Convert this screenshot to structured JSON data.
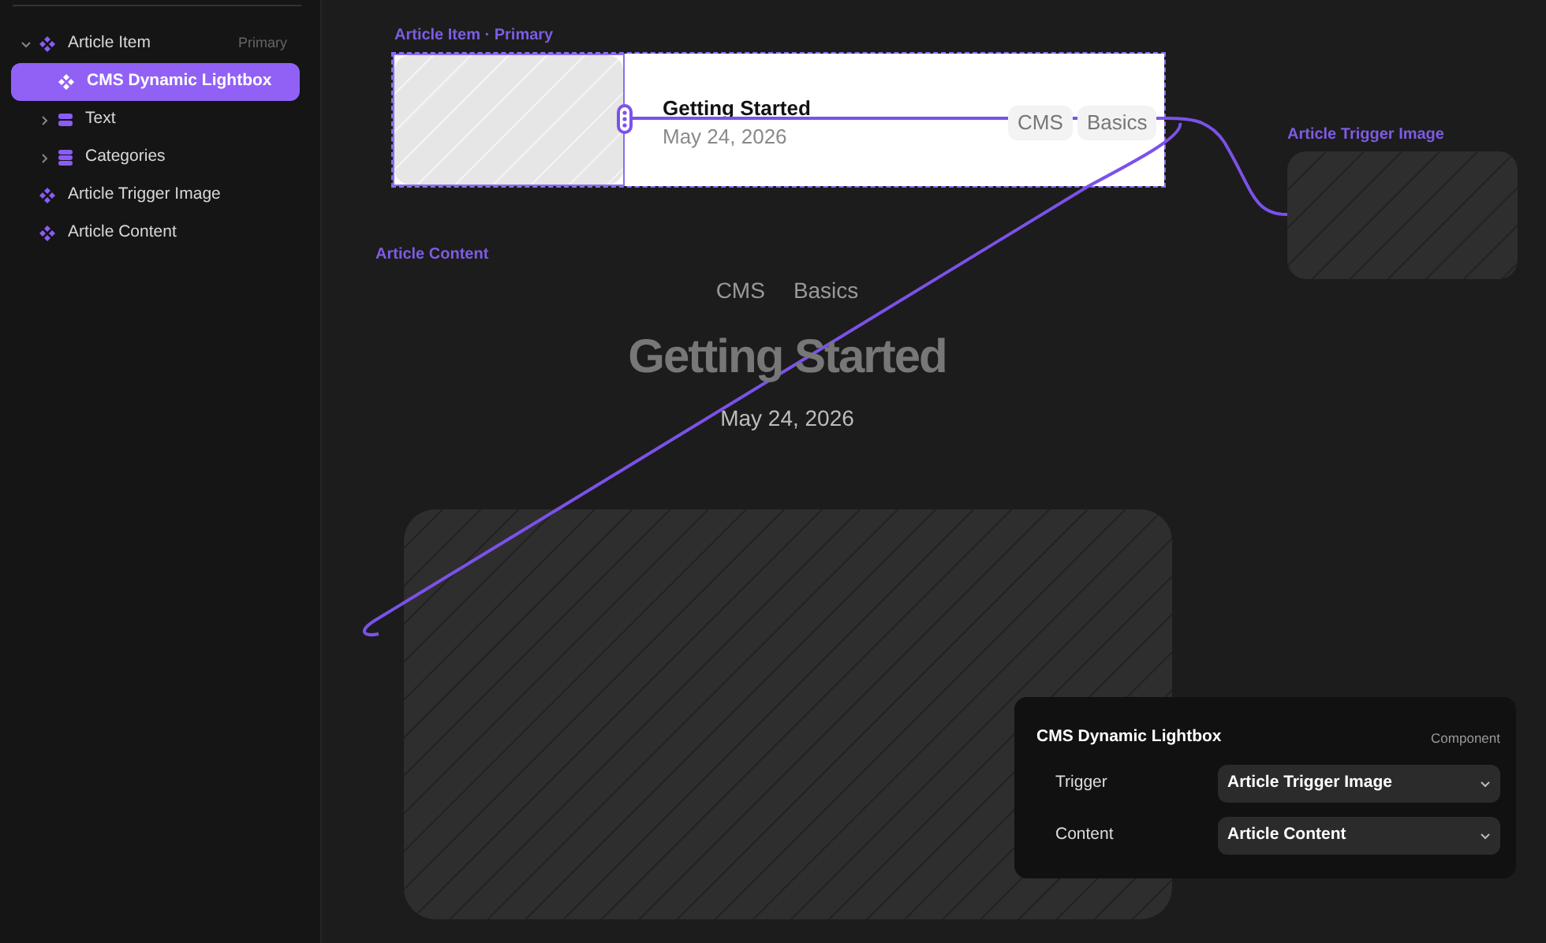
{
  "navigator": {
    "items": [
      {
        "label": "Article Item",
        "kind": "component",
        "badge": "Primary",
        "expanded": true,
        "selected": false,
        "children": [
          {
            "label": "CMS Dynamic Lightbox",
            "kind": "component",
            "selected": true
          },
          {
            "label": "Text",
            "kind": "field",
            "expanded": false,
            "selected": false
          },
          {
            "label": "Categories",
            "kind": "collection",
            "expanded": false,
            "selected": false
          }
        ]
      },
      {
        "label": "Article Trigger Image",
        "kind": "component",
        "selected": false
      },
      {
        "label": "Article Content",
        "kind": "component",
        "selected": false
      }
    ]
  },
  "canvas": {
    "article_item": {
      "label": "Article Item · Primary",
      "title": "Getting Started",
      "date": "May 24, 2026",
      "tags": [
        "CMS",
        "Basics"
      ]
    },
    "trigger_image": {
      "label": "Article Trigger Image"
    },
    "article_content": {
      "label": "Article Content",
      "tags": [
        "CMS",
        "Basics"
      ],
      "title": "Getting Started",
      "date": "May 24, 2026"
    }
  },
  "panel": {
    "title": "CMS Dynamic Lightbox",
    "type": "Component",
    "fields": [
      {
        "label": "Trigger",
        "value": "Article Trigger Image"
      },
      {
        "label": "Content",
        "value": "Article Content"
      }
    ]
  }
}
